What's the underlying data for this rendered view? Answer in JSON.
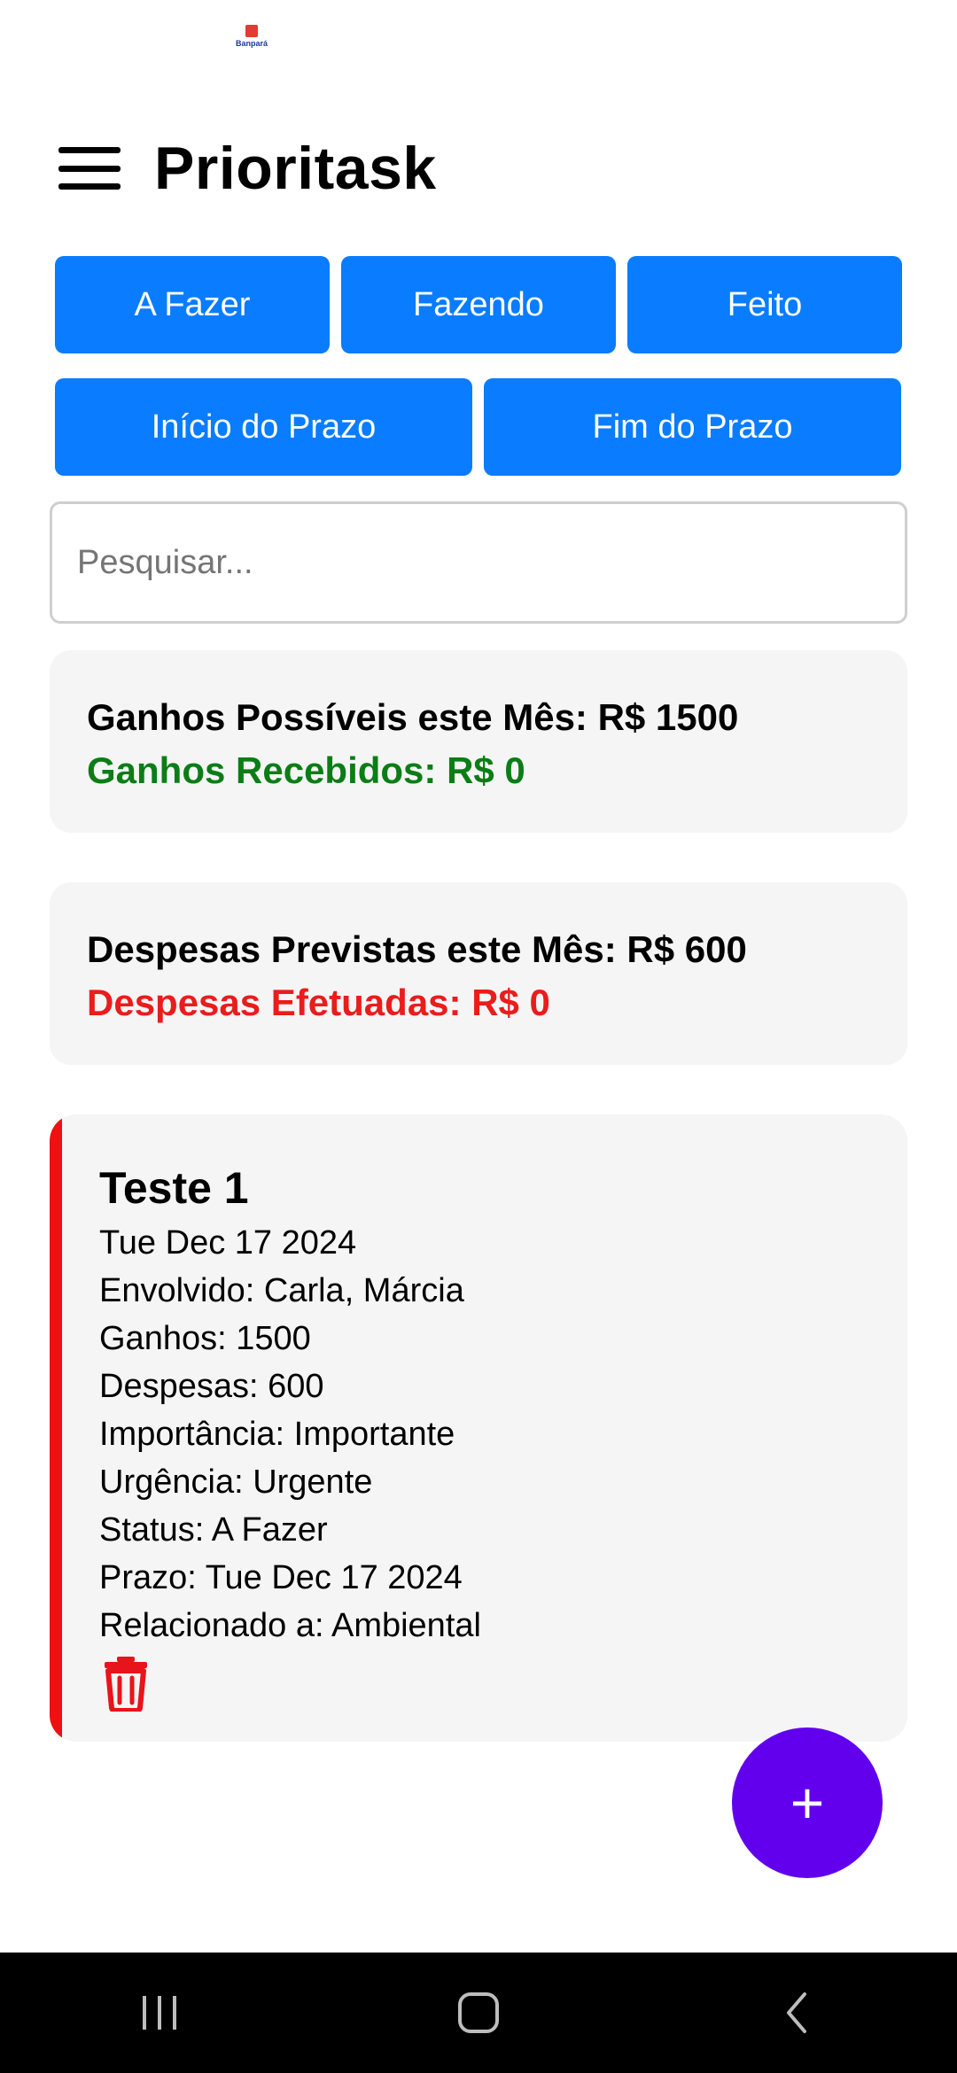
{
  "status_bar": {
    "logo_text": "Banpará"
  },
  "header": {
    "title": "Prioritask",
    "menu_icon": "hamburger-menu-icon"
  },
  "filters": {
    "row1": [
      "A Fazer",
      "Fazendo",
      "Feito"
    ],
    "row2": [
      "Início do Prazo",
      "Fim do Prazo"
    ]
  },
  "search": {
    "placeholder": "Pesquisar...",
    "value": ""
  },
  "earnings": {
    "possible": "Ganhos Possíveis este Mês: R$ 1500",
    "received": "Ganhos Recebidos: R$ 0"
  },
  "expenses": {
    "planned": "Despesas Previstas este Mês: R$ 600",
    "paid": "Despesas Efetuadas: R$ 0"
  },
  "task": {
    "title": "Teste 1",
    "date": "Tue Dec 17 2024",
    "involved": "Envolvido: Carla, Márcia",
    "earnings": "Ganhos: 1500",
    "expenses": "Despesas: 600",
    "importance": "Importância: Importante",
    "urgency": "Urgência: Urgente",
    "status": "Status: A Fazer",
    "deadline": "Prazo: Tue Dec 17 2024",
    "related": "Relacionado a: Ambiental",
    "delete_icon": "trash-icon"
  },
  "fab": {
    "label": "+"
  },
  "colors": {
    "primary_button": "#0a7cff",
    "fab": "#6200ee",
    "income": "#0b7d16",
    "expense": "#ea1c1c",
    "task_accent": "#f01010"
  },
  "navigation_bar": {
    "icons": [
      "recent-apps-icon",
      "home-icon",
      "back-icon"
    ]
  }
}
